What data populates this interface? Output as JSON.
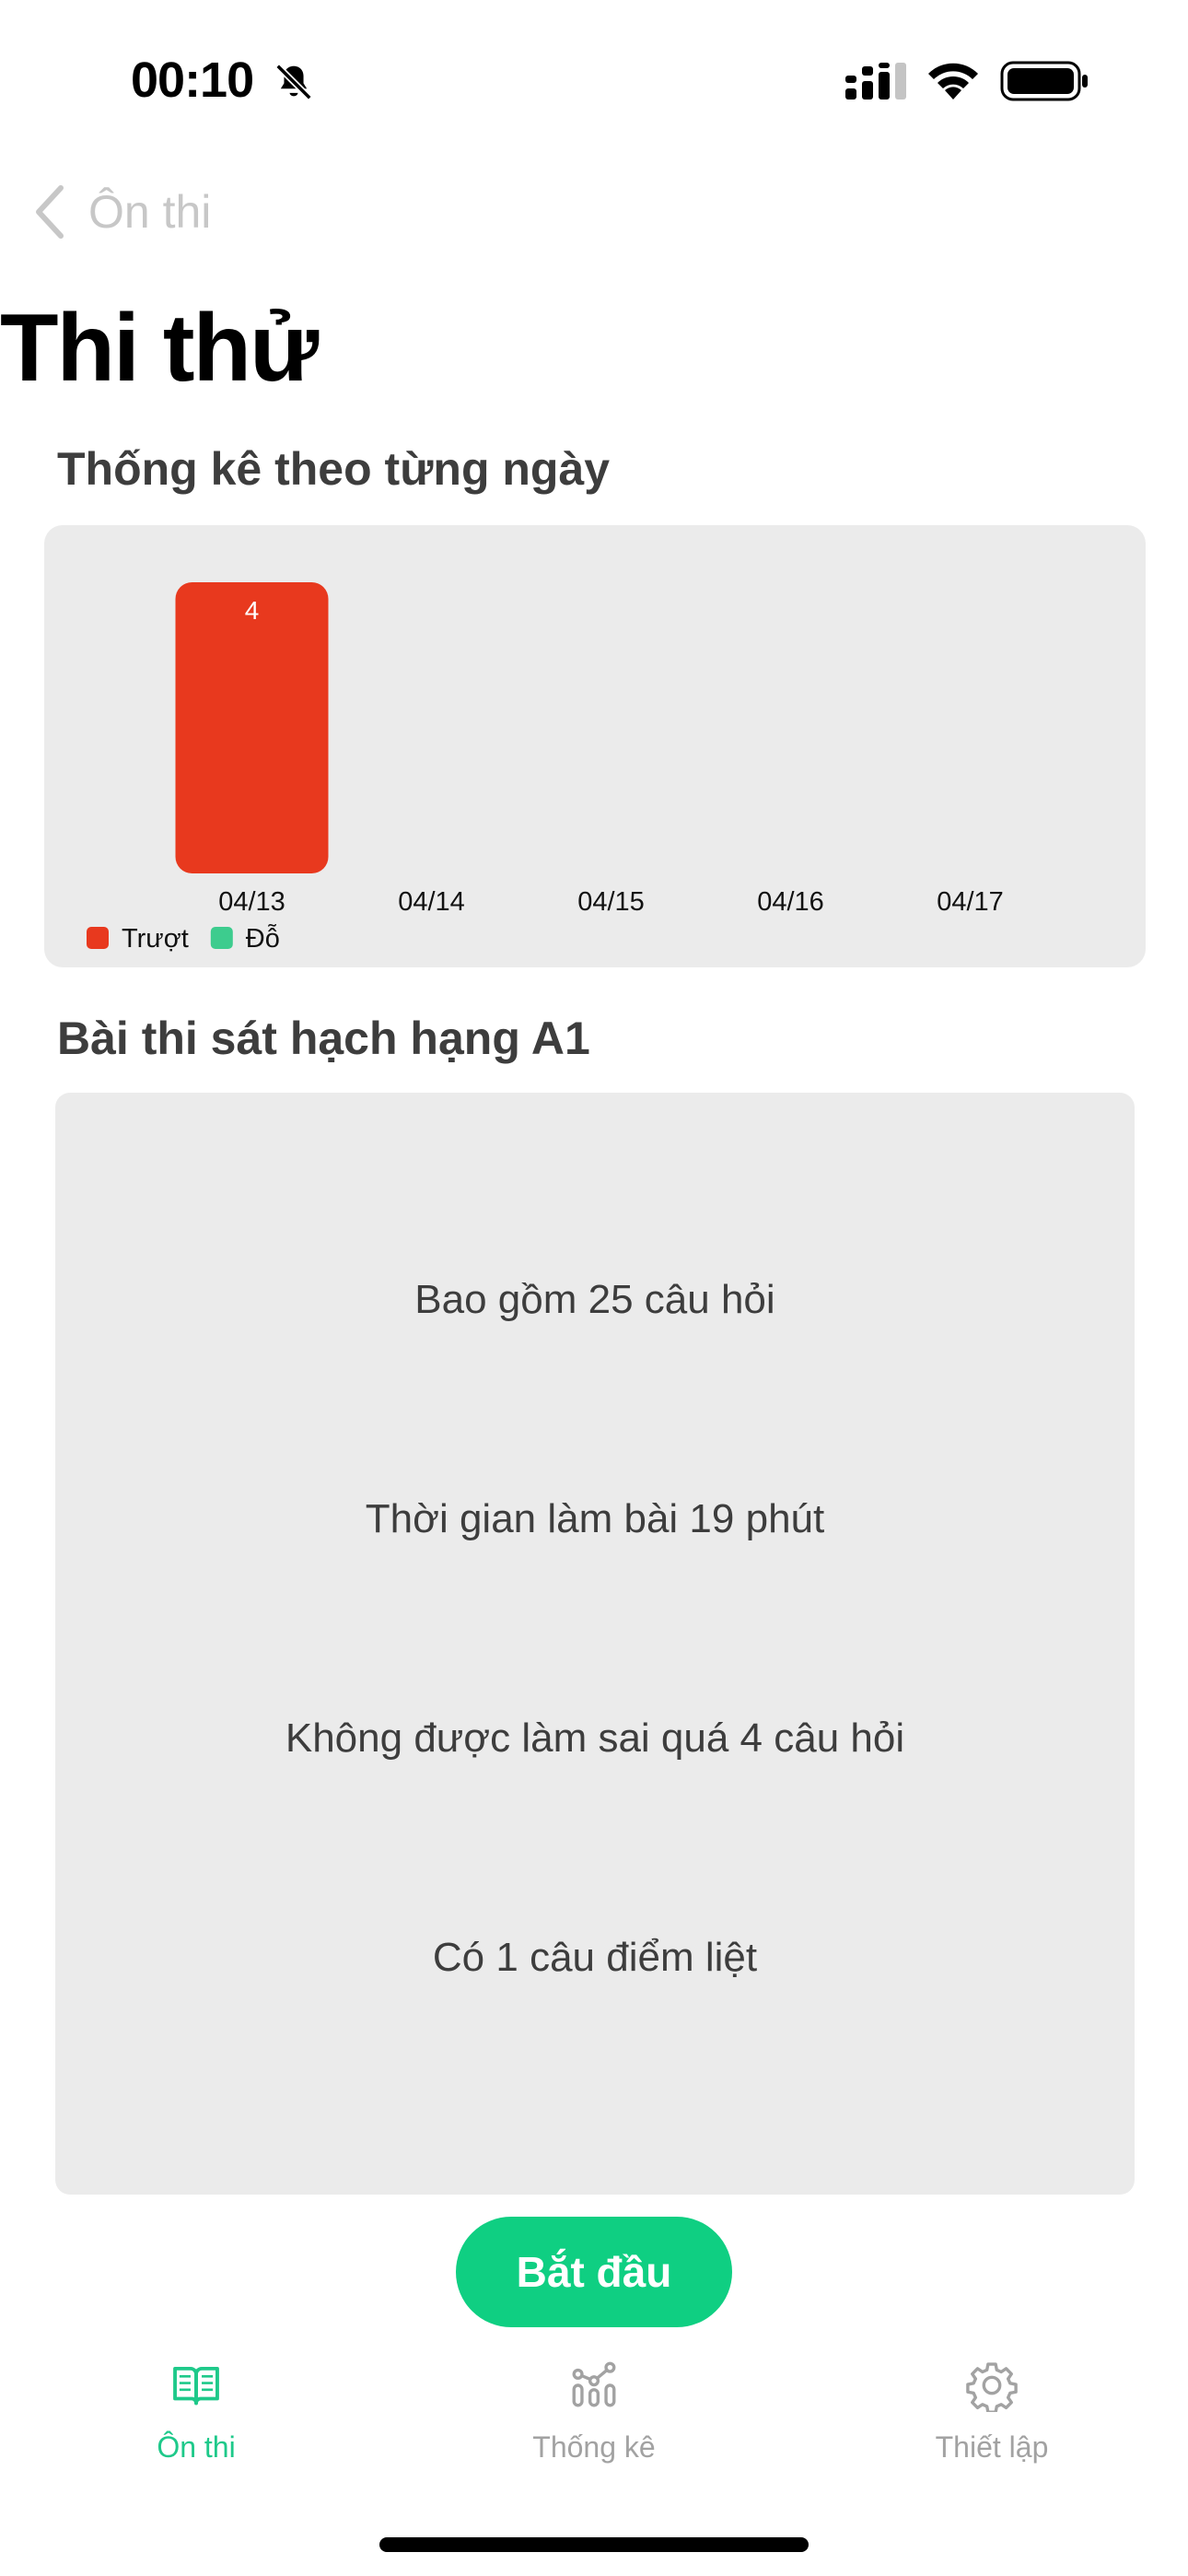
{
  "status_bar": {
    "time": "00:10"
  },
  "nav": {
    "back_label": "Ôn thi"
  },
  "page": {
    "title": "Thi thử"
  },
  "daily_stats": {
    "title": "Thống kê theo từng ngày"
  },
  "chart_data": {
    "type": "bar",
    "categories": [
      "04/13",
      "04/14",
      "04/15",
      "04/16",
      "04/17"
    ],
    "series": [
      {
        "name": "Trượt",
        "values": [
          4,
          0,
          0,
          0,
          0
        ],
        "color": "#e8391e"
      },
      {
        "name": "Đỗ",
        "values": [
          0,
          0,
          0,
          0,
          0
        ],
        "color": "#3dcc8e"
      }
    ],
    "data_labels": [
      "4",
      "",
      "",
      "",
      ""
    ],
    "legend": "bottom-left",
    "grid": false
  },
  "exam": {
    "title": "Bài thi sát hạch hạng A1",
    "lines": [
      "Bao gồm 25 câu hỏi",
      "Thời gian làm bài 19 phút",
      "Không được làm sai quá 4 câu hỏi",
      "Có 1 câu điểm liệt"
    ],
    "start_label": "Bắt đầu"
  },
  "tabs": [
    {
      "label": "Ôn thi",
      "icon": "book-icon",
      "active": true
    },
    {
      "label": "Thống kê",
      "icon": "chart-icon",
      "active": false
    },
    {
      "label": "Thiết lập",
      "icon": "gear-icon",
      "active": false
    }
  ],
  "colors": {
    "accent": "#0fcf82",
    "fail": "#e8391e",
    "pass": "#3dcc8e"
  }
}
